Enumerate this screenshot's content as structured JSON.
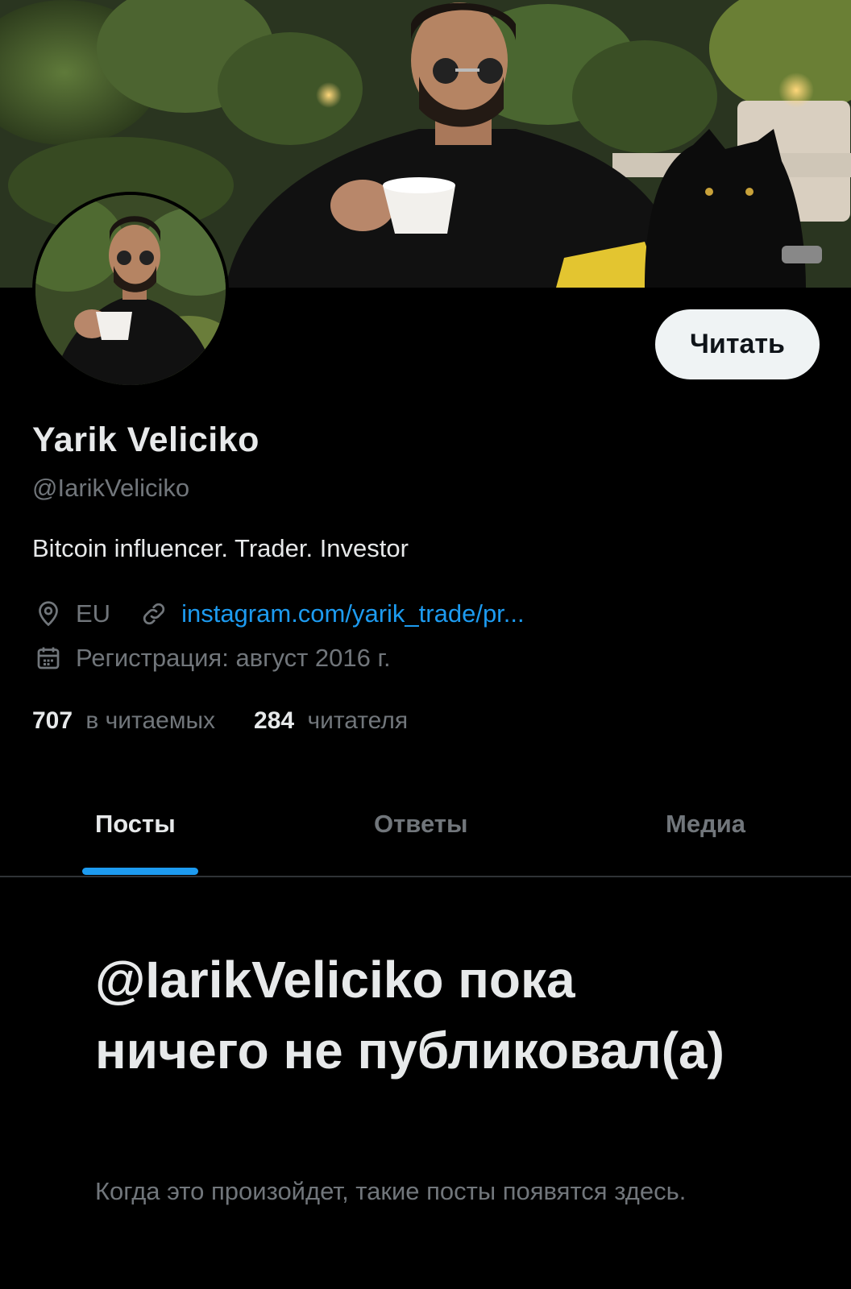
{
  "profile": {
    "name": "Yarik Veliciko",
    "handle": "@IarikVeliciko",
    "bio": "Bitcoin influencer. Trader. Investor",
    "location": "EU",
    "website": "instagram.com/yarik_trade/pr...",
    "joined": "Регистрация: август 2016 г.",
    "following_count": "707",
    "following_label": "в читаемых",
    "followers_count": "284",
    "followers_label": "читателя",
    "follow_button_label": "Читать",
    "banner_image": "man-with-coffee-and-panther-photo",
    "avatar_image": "man-with-coffee-photo"
  },
  "tabs": [
    {
      "label": "Посты",
      "active": true
    },
    {
      "label": "Ответы",
      "active": false
    },
    {
      "label": "Медиа",
      "active": false
    }
  ],
  "empty_state": {
    "title": "@IarikVeliciko пока ничего не публиковал(а)",
    "subtitle": "Когда это произойдет, такие посты появятся здесь."
  },
  "colors": {
    "background": "#000000",
    "text_primary": "#e7e9ea",
    "text_secondary": "#71767b",
    "accent": "#1d9bf0",
    "button_bg": "#eff3f4"
  },
  "icons": {
    "location": "location-pin-icon",
    "link": "link-icon",
    "calendar": "calendar-icon"
  }
}
